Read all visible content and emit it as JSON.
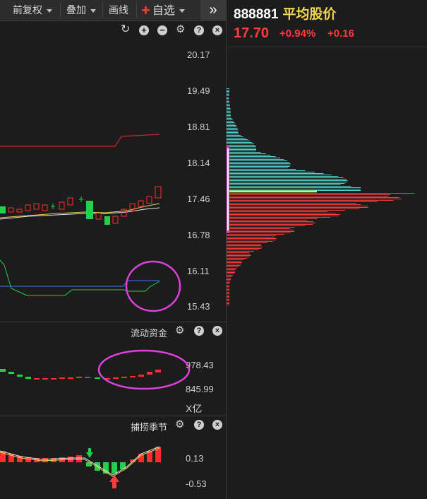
{
  "toolbar": {
    "fuquan": "前复权",
    "diejia": "叠加",
    "huaxian": "画线",
    "zixuan": "自选",
    "plus": "+",
    "more": "»"
  },
  "quote": {
    "code": "888881",
    "name": "平均股价",
    "price": "17.70",
    "change_pct": "+0.94%",
    "change": "+0.16"
  },
  "main_axis": [
    "20.17",
    "19.49",
    "18.81",
    "18.14",
    "17.46",
    "16.78",
    "16.11",
    "15.43"
  ],
  "panel2": {
    "title": "流动资金",
    "ticks": [
      "978.43",
      "845.99"
    ],
    "unit": "X亿"
  },
  "panel3": {
    "title": "捕捞季节",
    "ticks": [
      "0.13",
      "-0.53"
    ]
  },
  "colors": {
    "up": "#ff2d2d",
    "down": "#22d04c",
    "accent": "#e040e0",
    "profile_top": "#4fd3cf",
    "profile_bottom": "#ff3b3b",
    "cost_line": "#f0f000"
  },
  "icons": {
    "restore": "restore-icon",
    "zoom_in": "zoom-in-icon",
    "zoom_out": "zoom-out-icon",
    "settings": "gear-icon",
    "help": "help-icon",
    "close": "close-icon"
  }
}
